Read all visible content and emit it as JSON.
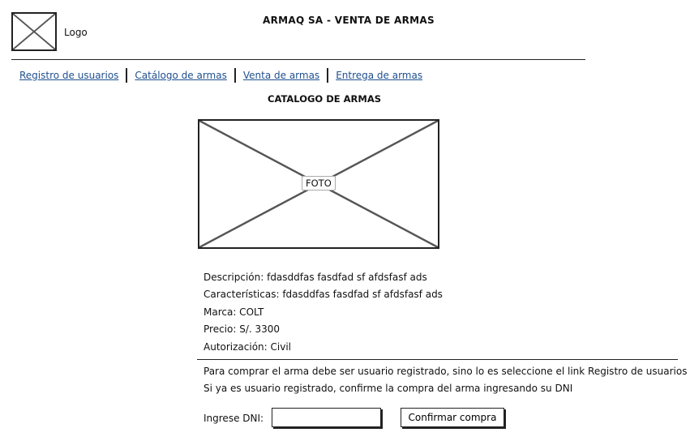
{
  "header": {
    "logo_label": "Logo",
    "title": "ARMAQ SA - VENTA DE ARMAS"
  },
  "nav": {
    "items": [
      {
        "label": "Registro de usuarios"
      },
      {
        "label": "Catálogo de armas"
      },
      {
        "label": "Venta de armas"
      },
      {
        "label": "Entrega de armas"
      }
    ]
  },
  "catalog": {
    "title": "CATALOGO DE ARMAS",
    "photo_label": "FOTO",
    "details": {
      "descripcion": "Descripción: fdasddfas fasdfad sf afdsfasf ads",
      "caracteristicas": "Características: fdasddfas fasdfad sf afdsfasf ads",
      "marca": "Marca: COLT",
      "precio": "Precio: S/. 3300",
      "autorizacion": "Autorización: Civil"
    }
  },
  "purchase": {
    "message_1": "Para comprar el arma debe ser usuario registrado, sino lo es seleccione el link Registro de usuarios",
    "message_2": "Si ya es usuario registrado, confirme la compra del arma ingresando su DNI",
    "dni_label": "Ingrese DNI:",
    "dni_value": "",
    "confirm_label": "Confirmar compra"
  },
  "colors": {
    "link": "#1f4f8f",
    "border": "#222222",
    "placeholder_stroke": "#555555"
  }
}
